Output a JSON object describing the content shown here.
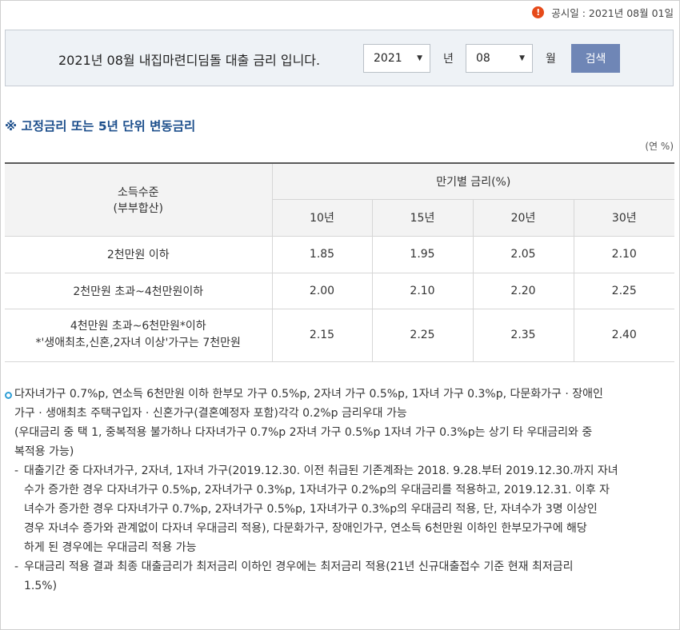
{
  "announce": {
    "text": "공시일 : 2021년 08월 01일",
    "icon": "exclamation-icon",
    "icon_glyph": "!"
  },
  "search": {
    "title": "2021년 08월 내집마련디딤돌 대출 금리 입니다.",
    "year_value": "2021",
    "year_unit": "년",
    "month_value": "08",
    "month_unit": "월",
    "button": "검색"
  },
  "section": {
    "title": "※ 고정금리 또는 5년 단위 변동금리",
    "unit": "(연 %)"
  },
  "table": {
    "income_header_1": "소득수준",
    "income_header_2": "(부부합산)",
    "term_header": "만기별 금리(%)",
    "terms": [
      "10년",
      "15년",
      "20년",
      "30년"
    ],
    "rows": [
      {
        "label": "2천만원 이하",
        "label2": "",
        "values": [
          "1.85",
          "1.95",
          "2.05",
          "2.10"
        ]
      },
      {
        "label": "2천만원 초과~4천만원이하",
        "label2": "",
        "values": [
          "2.00",
          "2.10",
          "2.20",
          "2.25"
        ]
      },
      {
        "label": "4천만원 초과~6천만원*이하",
        "label2": "*'생애최초,신혼,2자녀 이상'가구는 7천만원",
        "values": [
          "2.15",
          "2.25",
          "2.35",
          "2.40"
        ]
      }
    ]
  },
  "notes": {
    "bullet_line1": "다자녀가구 0.7%p, 연소득 6천만원 이하 한부모 가구 0.5%p, 2자녀 가구 0.5%p, 1자녀 가구 0.3%p, 다문화가구 · 장애인",
    "bullet_line2": "가구 · 생애최초 주택구입자 · 신혼가구(결혼예정자 포함)각각 0.2%p 금리우대 가능",
    "bullet_line3": "(우대금리 중 택 1, 중복적용 불가하나 다자녀가구 0.7%p 2자녀 가구 0.5%p 1자녀 가구 0.3%p는 상기 타 우대금리와 중",
    "bullet_line4": "복적용 가능)",
    "dash_symbol": "-",
    "dash1_lines": [
      "대출기간 중 다자녀가구, 2자녀, 1자녀 가구(2019.12.30. 이전 취급된 기존계좌는 2018. 9.28.부터 2019.12.30.까지 자녀",
      "수가 증가한 경우 다자녀가구 0.5%p, 2자녀가구 0.3%p, 1자녀가구 0.2%p의 우대금리를 적용하고, 2019.12.31. 이후 자",
      "녀수가 증가한 경우 다자녀가구 0.7%p, 2자녀가구 0.5%p, 1자녀가구 0.3%p의 우대금리 적용, 단, 자녀수가 3명 이상인",
      "경우 자녀수 증가와 관계없이 다자녀 우대금리 적용), 다문화가구, 장애인가구, 연소득 6천만원 이하인 한부모가구에 해당",
      "하게 된 경우에는 우대금리 적용 가능"
    ],
    "dash2_lines": [
      "우대금리 적용 결과 최종 대출금리가 최저금리 이하인 경우에는 최저금리 적용(21년 신규대출접수 기준 현재 최저금리",
      "1.5%)"
    ]
  },
  "colors": {
    "accent_blue": "#1d4f8c",
    "button_bg": "#6f86b6",
    "warn": "#e64a19",
    "bullet": "#2f9fd6"
  }
}
